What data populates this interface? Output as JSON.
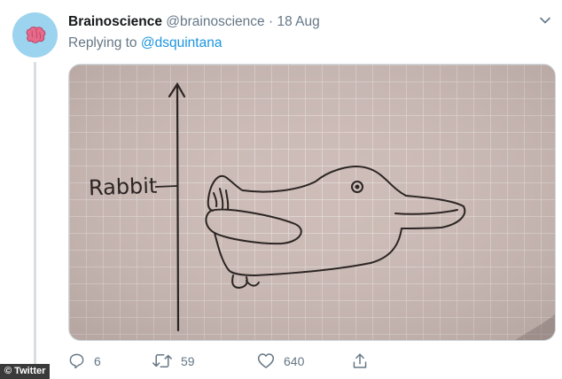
{
  "tweet": {
    "display_name": "Brainoscience",
    "handle": "@brainoscience",
    "separator": "·",
    "date": "18 Aug",
    "replying_prefix": "Replying to",
    "replying_handle": "@dsquintana"
  },
  "drawing": {
    "axis_label": "Rabbit"
  },
  "actions": {
    "replies": "6",
    "retweets": "59",
    "likes": "640"
  },
  "watermark": "© Twitter",
  "colors": {
    "link": "#1b95e0",
    "muted": "#657786",
    "avatar_bg": "#9cd3ee",
    "paper": "#cdbcb7"
  }
}
